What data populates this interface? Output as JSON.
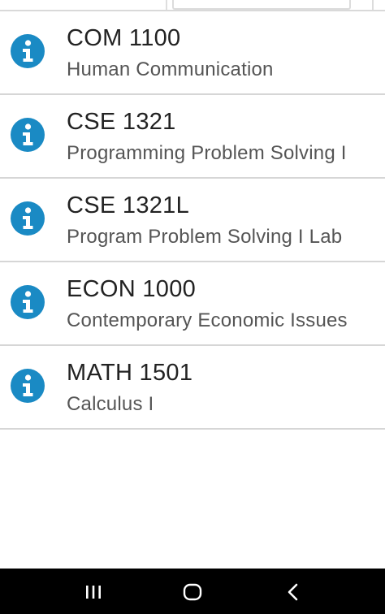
{
  "courses": [
    {
      "code": "COM 1100",
      "title": "Human Communication"
    },
    {
      "code": "CSE 1321",
      "title": "Programming Problem Solving I"
    },
    {
      "code": "CSE 1321L",
      "title": "Program Problem Solving I Lab"
    },
    {
      "code": "ECON 1000",
      "title": "Contemporary Economic Issues"
    },
    {
      "code": "MATH 1501",
      "title": "Calculus I"
    }
  ],
  "icons": {
    "info": "info-icon",
    "recents": "recents-icon",
    "home": "home-icon",
    "back": "back-icon"
  },
  "colors": {
    "accent": "#1a8ac4",
    "nav_bar": "#000000"
  }
}
